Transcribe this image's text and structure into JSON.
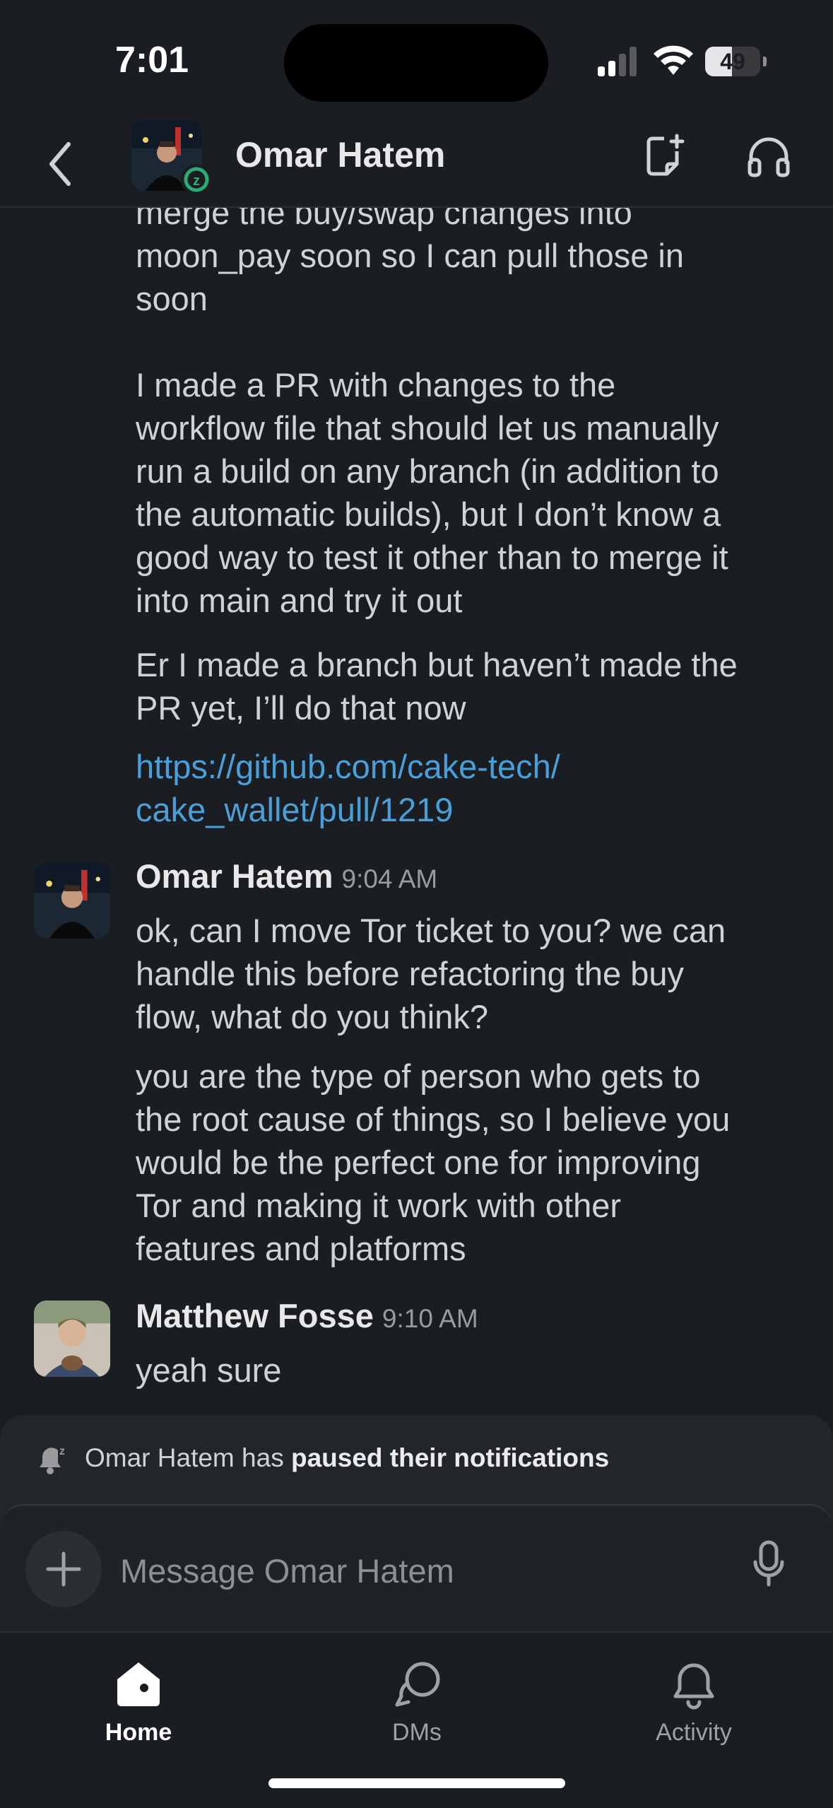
{
  "status_bar": {
    "time": "7:01",
    "battery": "49",
    "battery_level": 0.49
  },
  "header": {
    "title": "Omar Hatem"
  },
  "messages": {
    "continuation_1": "merge the buy/swap changes into\nmoon_pay soon so I can pull those in\nsoon\n\nI made a PR with changes to the\nworkflow file that should let us manually\nrun a build on any branch (in addition to\nthe automatic builds), but I don’t know a\ngood way to test it other than to merge it\ninto main and try it out",
    "continuation_2": "Er I made a branch but haven’t made the\nPR yet, I’ll do that now",
    "link": "https://github.com/cake-tech/\ncake_wallet/pull/1219",
    "omar": {
      "sender": "Omar Hatem",
      "time": "9:04 AM",
      "text_1": "ok, can I move Tor ticket to you? we can\nhandle this before refactoring the buy\nflow, what do you think?",
      "text_2": "you are the type of person who gets to\nthe root cause of things, so I believe you\nwould be the perfect one for improving\nTor and making it work with other\nfeatures and platforms"
    },
    "matthew": {
      "sender": "Matthew Fosse",
      "time": "9:10 AM",
      "text": "yeah sure"
    }
  },
  "notice": {
    "prefix": "Omar Hatem has ",
    "bold": "paused their notifications"
  },
  "composer": {
    "placeholder": "Message Omar Hatem"
  },
  "tabs": [
    {
      "label": "Home",
      "icon": "home-icon",
      "active": true
    },
    {
      "label": "DMs",
      "icon": "dms-icon",
      "active": false
    },
    {
      "label": "Activity",
      "icon": "bell-icon",
      "active": false
    }
  ]
}
